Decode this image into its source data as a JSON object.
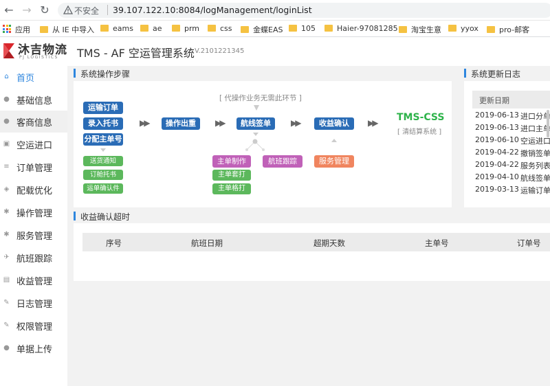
{
  "browser": {
    "insecure_label": "不安全",
    "url": "39.107.122.10:8084/logManagement/loginList",
    "bookmarks": [
      "应用",
      "从 IE 中导入",
      "eams",
      "ae",
      "prm",
      "css",
      "金蝶EAS",
      "105",
      "Haier-97081285",
      "淘宝生意",
      "yyox",
      "pro-邮客"
    ]
  },
  "header": {
    "logo_text": "沐吉物流",
    "logo_sub": "PJ LOGISTICS",
    "title": "TMS - AF 空运管理系统",
    "version": "V.2101221345"
  },
  "sidebar": {
    "items": [
      {
        "label": "首页",
        "icon": "home-icon"
      },
      {
        "label": "基础信息",
        "icon": "user-icon"
      },
      {
        "label": "客商信息",
        "icon": "user-icon"
      },
      {
        "label": "空运进口",
        "icon": "box-icon"
      },
      {
        "label": "订单管理",
        "icon": "list-icon"
      },
      {
        "label": "配载优化",
        "icon": "layers-icon"
      },
      {
        "label": "操作管理",
        "icon": "gear-icon"
      },
      {
        "label": "服务管理",
        "icon": "gear-icon"
      },
      {
        "label": "航班跟踪",
        "icon": "plane-icon"
      },
      {
        "label": "收益管理",
        "icon": "chart-icon"
      },
      {
        "label": "日志管理",
        "icon": "edit-icon"
      },
      {
        "label": "权限管理",
        "icon": "edit-icon"
      },
      {
        "label": "单据上传",
        "icon": "user-icon"
      }
    ]
  },
  "steps_panel": {
    "title": "系统操作步骤",
    "optional_note": "[ 代操作业务无需此环节 ]",
    "steps": {
      "transport_order": "运输订单",
      "entry_consign": "录入托书",
      "assign_master": "分配主单号",
      "delivery_notice": "送货通知",
      "booking_consign": "订舱托书",
      "confirm_waybill": "运单确认件",
      "operation_out": "操作出重",
      "flight_sign": "航线签单",
      "master_make": "主单制作",
      "master_print_set": "主单套打",
      "master_print_format": "主单格打",
      "flight_track": "航班跟踪",
      "revenue_confirm": "收益确认",
      "service_manage": "服务管理"
    },
    "tms_css": "TMS-CSS",
    "tms_css_sub": "[ 清结算系统 ]"
  },
  "update_log": {
    "title": "系统更新日志",
    "header": "更新日期",
    "rows": [
      {
        "date": "2019-06-13",
        "content": "进口分单"
      },
      {
        "date": "2019-06-13",
        "content": "进口主单"
      },
      {
        "date": "2019-06-10",
        "content": "空运进口"
      },
      {
        "date": "2019-04-22",
        "content": "撤销签单"
      },
      {
        "date": "2019-04-22",
        "content": "服务列表"
      },
      {
        "date": "2019-04-10",
        "content": "航线签单"
      },
      {
        "date": "2019-03-13",
        "content": "运输订单"
      }
    ]
  },
  "timeout_panel": {
    "title": "收益确认超时",
    "columns": [
      "序号",
      "航班日期",
      "超期天数",
      "主单号",
      "订单号"
    ]
  },
  "colors": {
    "accent": "#2e86de",
    "step_blue": "#2a6cb6",
    "step_green": "#5cb85c",
    "step_purple": "#c061b8",
    "step_orange": "#f0855f",
    "tms_green": "#2db34a"
  }
}
